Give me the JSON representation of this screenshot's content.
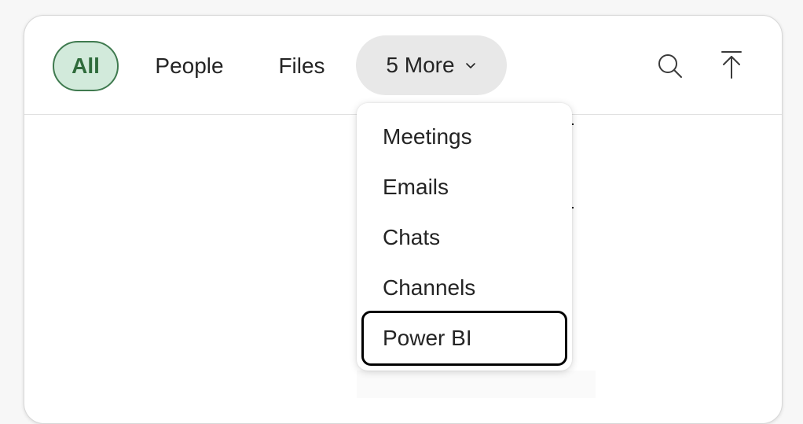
{
  "filters": {
    "all": "All",
    "people": "People",
    "files": "Files",
    "more": "5 More"
  },
  "icons": {
    "search": "search-icon",
    "chevron": "chevron-down-icon",
    "top": "arrow-up-to-top-icon"
  },
  "menu": {
    "items": [
      "Meetings",
      "Emails",
      "Chats",
      "Channels",
      "Power BI"
    ],
    "focused": "Power BI"
  },
  "colors": {
    "active_pill_bg": "#d2eadb",
    "active_pill_border": "#3f7a4f",
    "active_pill_text": "#2f6b3b",
    "more_pill_bg": "#e8e8e8"
  }
}
